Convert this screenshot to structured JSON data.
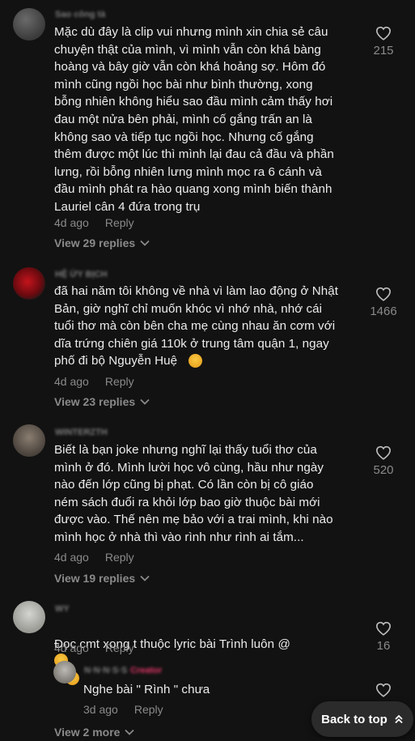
{
  "comments": [
    {
      "username": "Sao công tà",
      "text": "Mặc dù đây là clip vui nhưng mình xin chia sẻ câu\nchuyện thật của mình, vì mình vẫn còn khá bàng\nhoàng và bây giờ vẫn còn khá hoảng sợ. Hôm đó\nmình cũng ngồi học bài như bình thường, xong\nbỗng nhiên không hiểu sao đầu mình cảm thấy hơi\nđau một nửa bên phải, mình cố gắng trấn an là\nkhông sao và tiếp tục ngồi học. Nhưng cố gắng\nthêm được một lúc thì mình lại đau cả đầu và phần\nlưng, rồi bỗng nhiên lưng mình mọc ra 6 cánh và\nđầu mình phát ra hào quang xong mình biến thành\nLauriel cân 4 đứa trong trụ",
      "time": "4d ago",
      "reply": "Reply",
      "view_replies": "View 29 replies",
      "likes": "215"
    },
    {
      "username": "HỆ ỨY BỊCH",
      "text": "đã hai năm tôi không về nhà vì làm lao động ở Nhật\nBản, giờ nghĩ chỉ muốn khóc vì nhớ nhà, nhớ cái\ntuổi thơ mà còn bên cha mẹ cùng nhau ăn cơm với\ndĩa trứng chiên giá 110k ở trung tâm quận 1, ngay\nphố đi bộ Nguyễn Huệ",
      "time": "4d ago",
      "reply": "Reply",
      "view_replies": "View 23 replies",
      "likes": "1466"
    },
    {
      "username": "WINTERZTH",
      "text": "Biết là bạn joke nhưng nghĩ lại thấy tuổi thơ của\nmình ở đó. Mình lười học vô cùng, hầu như ngày\nnào đến lớp cũng bị phạt. Có lần còn bị cô giáo\nném sách đuổi ra khỏi lớp bao giờ thuộc bài mới\nđược vào. Thế nên mẹ bảo với a trai mình, khi nào\nmình học ở nhà thì vào rình như rình ai tắm...",
      "time": "4d ago",
      "reply": "Reply",
      "view_replies": "View 19 replies",
      "likes": "520"
    },
    {
      "username": "WY",
      "text": "Đọc cmt xong t thuộc lyric bài Trình luôn @",
      "time": "4d ago",
      "reply": "Reply",
      "likes": "16"
    }
  ],
  "nested_reply": {
    "username": "N·N·N·S·S",
    "badge": "Creator",
    "text": "Nghe bài \" Rình \" chưa",
    "time": "3d ago",
    "reply": "Reply"
  },
  "view_more": "View 2 more",
  "back_to_top": "Back to top",
  "colors": {
    "background": "#121212",
    "text": "#ececec",
    "muted": "#8a8a8a",
    "creator": "#e6386a"
  }
}
